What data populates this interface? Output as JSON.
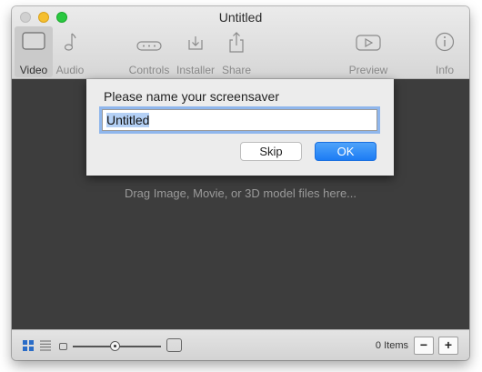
{
  "window": {
    "title": "Untitled"
  },
  "toolbar": {
    "video_label": "Video",
    "audio_label": "Audio",
    "controls_label": "Controls",
    "installer_label": "Installer",
    "share_label": "Share",
    "preview_label": "Preview",
    "info_label": "Info"
  },
  "dialog": {
    "prompt": "Please name your screensaver",
    "name_value": "Untitled",
    "skip_label": "Skip",
    "ok_label": "OK"
  },
  "content": {
    "drop_hint": "Drag Image, Movie, or 3D model files here..."
  },
  "bottombar": {
    "items_count": "0 Items",
    "remove_label": "−",
    "add_label": "+",
    "thumbnail_size": 0.48
  },
  "colors": {
    "accent": "#1c7cf4",
    "content_bg": "#3d3d3d",
    "focus_ring": "#8fb6ec"
  }
}
